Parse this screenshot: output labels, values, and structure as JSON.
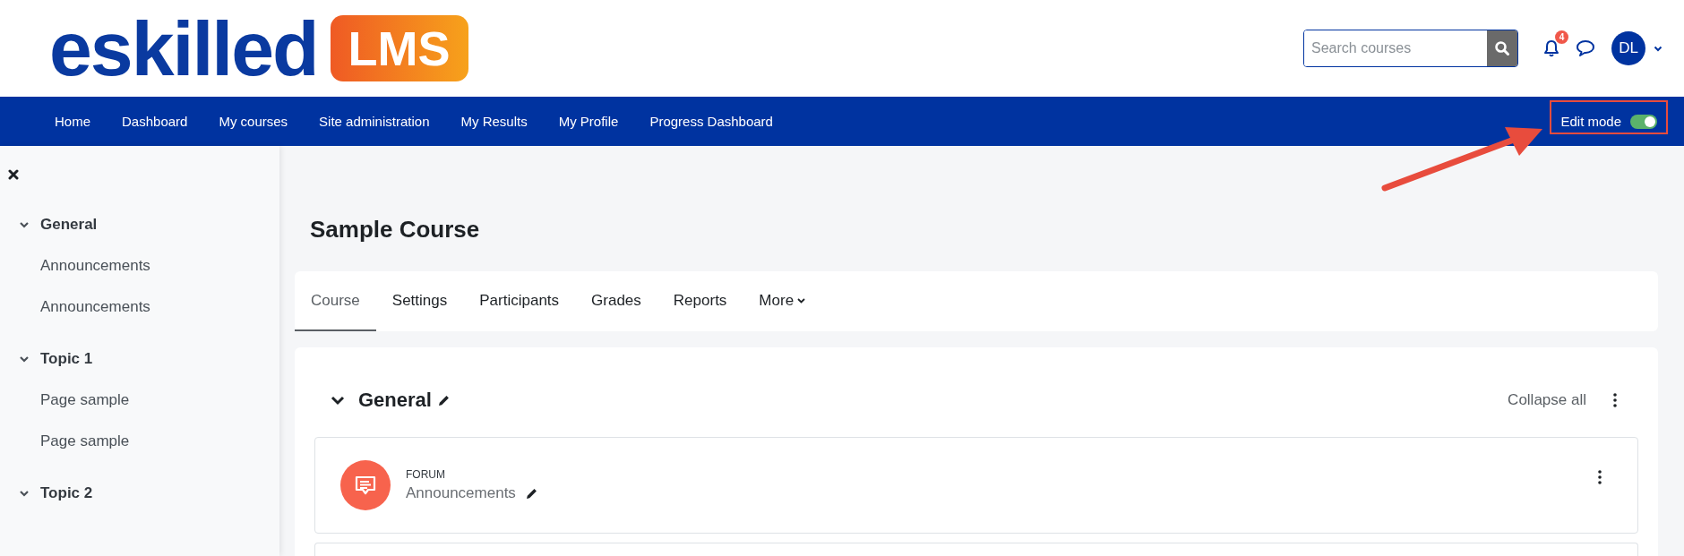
{
  "logo": {
    "word": "eskilled",
    "badge": "LMS"
  },
  "search": {
    "placeholder": "Search courses"
  },
  "notifications": {
    "count": "4"
  },
  "user": {
    "initials": "DL"
  },
  "nav": [
    {
      "label": "Home"
    },
    {
      "label": "Dashboard"
    },
    {
      "label": "My courses"
    },
    {
      "label": "Site administration"
    },
    {
      "label": "My Results"
    },
    {
      "label": "My Profile"
    },
    {
      "label": "Progress Dashboard"
    }
  ],
  "edit_mode": {
    "label": "Edit mode",
    "on": true
  },
  "drawer": {
    "sections": [
      {
        "title": "General",
        "expanded": true,
        "children": [
          {
            "label": "Announcements"
          },
          {
            "label": "Announcements"
          }
        ]
      },
      {
        "title": "Topic 1",
        "expanded": true,
        "children": [
          {
            "label": "Page sample"
          },
          {
            "label": "Page sample"
          }
        ]
      },
      {
        "title": "Topic 2",
        "expanded": true
      }
    ]
  },
  "course": {
    "title": "Sample Course",
    "tabs": [
      {
        "label": "Course",
        "selected": true,
        "dropdown": false
      },
      {
        "label": "Settings",
        "selected": false,
        "dropdown": false
      },
      {
        "label": "Participants",
        "selected": false,
        "dropdown": false
      },
      {
        "label": "Grades",
        "selected": false,
        "dropdown": false
      },
      {
        "label": "Reports",
        "selected": false,
        "dropdown": false
      },
      {
        "label": "More",
        "selected": false,
        "dropdown": true
      }
    ],
    "section": {
      "title": "General",
      "expanded": true,
      "collapse_label": "Collapse all",
      "activities": [
        {
          "type": "FORUM",
          "name": "Announcements"
        }
      ]
    }
  }
}
